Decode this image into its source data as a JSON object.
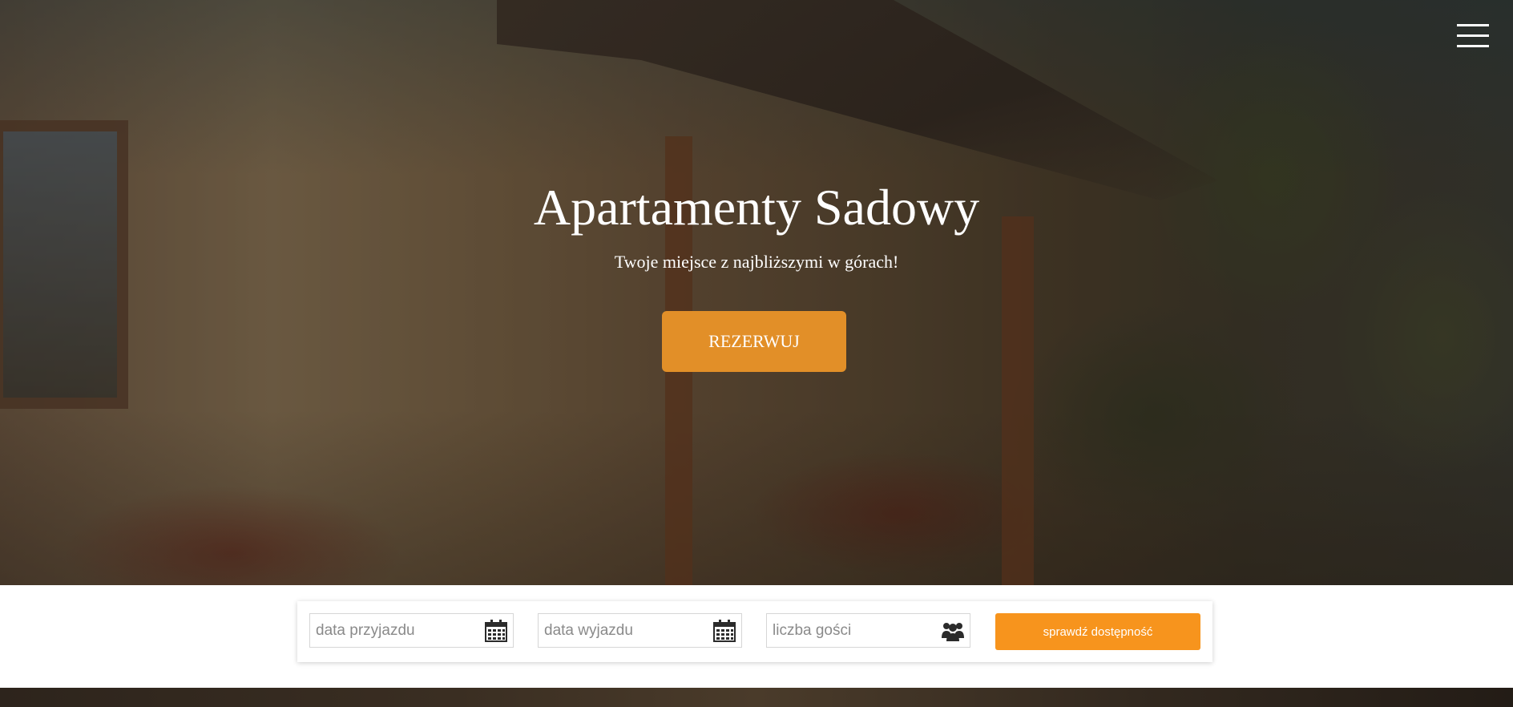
{
  "hero": {
    "title": "Apartamenty Sadowy",
    "subtitle": "Twoje miejsce z najbliższymi w górach!",
    "book_button_label": "REZERWUJ"
  },
  "menu": {
    "icon": "hamburger-menu-icon"
  },
  "booking": {
    "arrival_placeholder": "data przyjazdu",
    "departure_placeholder": "data wyjazdu",
    "guests_placeholder": "liczba gości",
    "check_button_label": "sprawdź dostępność",
    "arrival_icon": "calendar-icon",
    "departure_icon": "calendar-icon",
    "guests_icon": "users-icon"
  },
  "colors": {
    "accent": "#f7941d",
    "hero_button": "#e28f28",
    "text_light": "#ffffff"
  }
}
